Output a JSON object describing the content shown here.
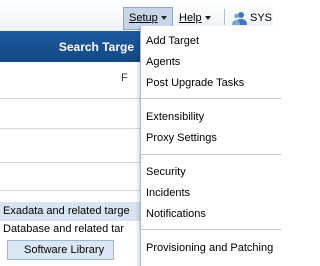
{
  "topbar": {
    "setup_label": "Setup",
    "help_label": "Help",
    "user_label": "SYS"
  },
  "header": {
    "search_label": "Search Targe"
  },
  "background": {
    "fragment_f": "F",
    "exadata_row": "Exadata and related targe",
    "database_row": "Database and related tar",
    "software_library": "Software Library"
  },
  "setup_menu": {
    "items": [
      "Add Target",
      "Agents",
      "Post Upgrade Tasks",
      "Extensibility",
      "Proxy Settings",
      "Security",
      "Incidents",
      "Notifications",
      "Provisioning and Patching"
    ]
  }
}
